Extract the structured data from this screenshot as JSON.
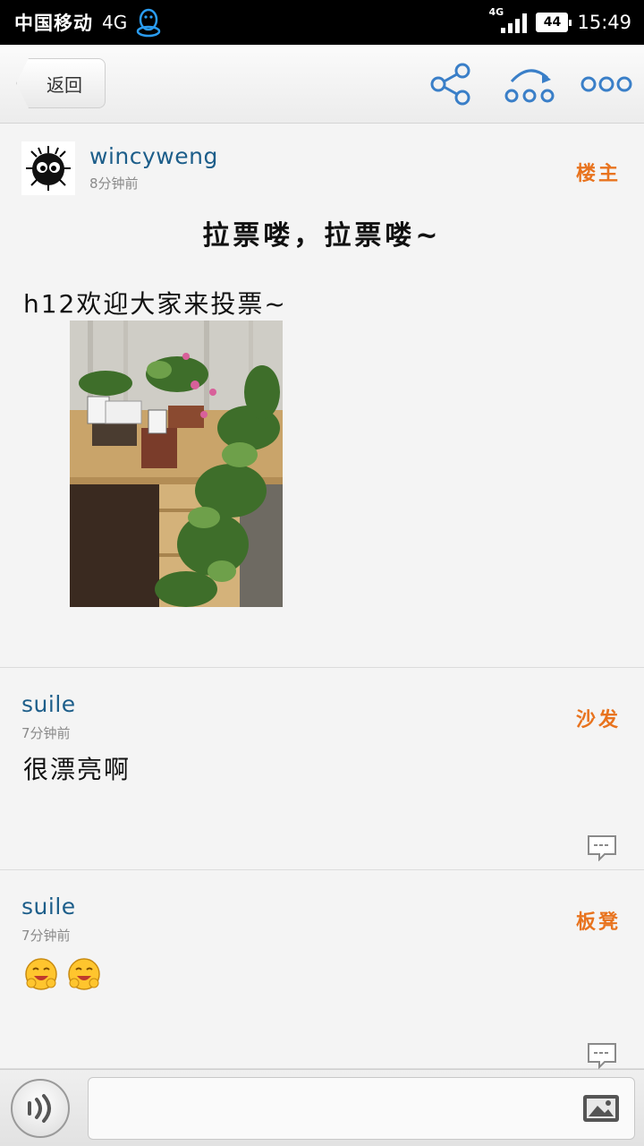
{
  "status_bar": {
    "carrier": "中国移动",
    "network": "4G",
    "signal_badge": "4G",
    "battery": "44",
    "time": "15:49"
  },
  "toolbar": {
    "back_label": "返回",
    "icons": [
      "share-icon",
      "forward-icon",
      "more-icon"
    ],
    "icon_color": "#3a7fc8"
  },
  "posts": [
    {
      "username": "wincyweng",
      "time": "8分钟前",
      "floor": "楼主",
      "title": "拉票喽，拉票喽~",
      "body": "h12欢迎大家来投票~",
      "has_photo": true
    },
    {
      "username": "suile",
      "time": "7分钟前",
      "floor": "沙发",
      "body": "很漂亮啊"
    },
    {
      "username": "suile",
      "time": "7分钟前",
      "floor": "板凳",
      "emoji_count": 2
    }
  ],
  "colors": {
    "username": "#1d5e8a",
    "floor_tag": "#e8731e",
    "accent_icon": "#3a7fc8"
  },
  "input_bar": {
    "placeholder": "",
    "icons": [
      "voice-icon",
      "image-icon"
    ]
  }
}
